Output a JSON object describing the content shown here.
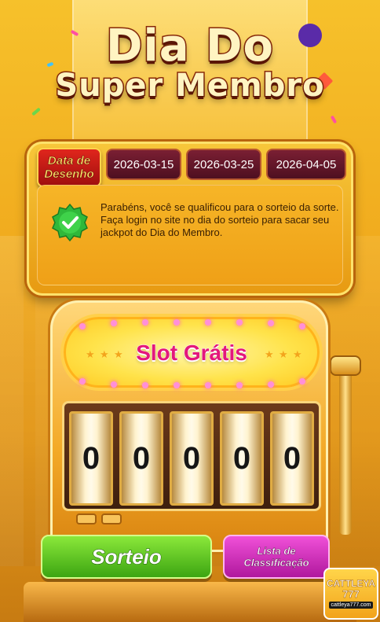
{
  "title": {
    "line1": "Dia Do",
    "line2": "Super Membro"
  },
  "draw_panel": {
    "label_line1": "Data de",
    "label_line2": "Desenho",
    "dates": [
      "2026-03-15",
      "2026-03-25",
      "2026-04-05"
    ],
    "message": "Parabéns, você se qualificou para o sorteio da sorte. Faça login no site no dia do sorteio para sacar seu jackpot do Dia do Membro."
  },
  "slot": {
    "marquee": "Slot Grátis",
    "reels": [
      "0",
      "0",
      "0",
      "0",
      "0"
    ]
  },
  "buttons": {
    "sorteio": "Sorteio",
    "lista_line1": "Lista de",
    "lista_line2": "Classificação"
  },
  "logo": {
    "name": "CATTLEYA",
    "number": "777",
    "url": "cattleya777.com"
  },
  "colors": {
    "accent_green": "#3ca512",
    "accent_pink": "#b0189d",
    "title_stroke": "#8a2a0a",
    "marquee_text": "#e4177b"
  }
}
